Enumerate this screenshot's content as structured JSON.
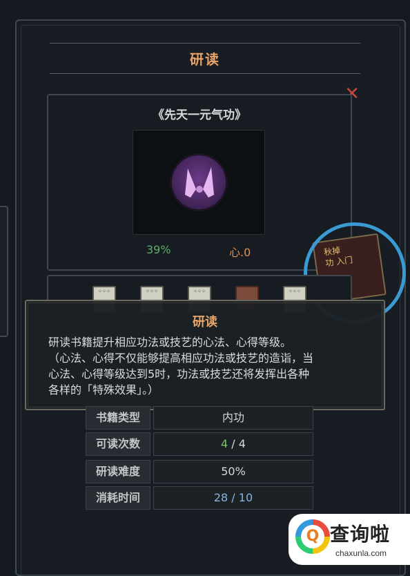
{
  "window": {
    "title": "研读"
  },
  "book": {
    "title": "《先天一元气功》",
    "progress": "39%",
    "heart_level": "心.0"
  },
  "annotation_book": {
    "text_lines": [
      "秋掉",
      "功",
      "入门"
    ]
  },
  "tooltip": {
    "title": "研读",
    "lines": [
      "研读书籍提升相应功法或技艺的心法、心得等级。",
      "（心法、心得不仅能够提高相应功法或技艺的造诣，当",
      "心法、心得等级达到5时，功法或技艺还将发挥出各种",
      "各样的「特殊效果」。）"
    ]
  },
  "stats": [
    {
      "label": "书籍类型",
      "value": "内功"
    },
    {
      "label": "可读次数",
      "value_current": "4",
      "value_sep": " / ",
      "value_total": "4"
    },
    {
      "label": "研读难度",
      "value": "50%"
    },
    {
      "label": "消耗时间",
      "value": "28 / 10"
    }
  ],
  "watermark": {
    "name": "查询啦",
    "url": "chaxunla.com",
    "logo_glyph": "Q"
  },
  "colors": {
    "accent": "#e8a468",
    "progress_green": "#5cb06a",
    "annotation_blue": "#3b9ad4",
    "close_red": "#c9483c"
  }
}
